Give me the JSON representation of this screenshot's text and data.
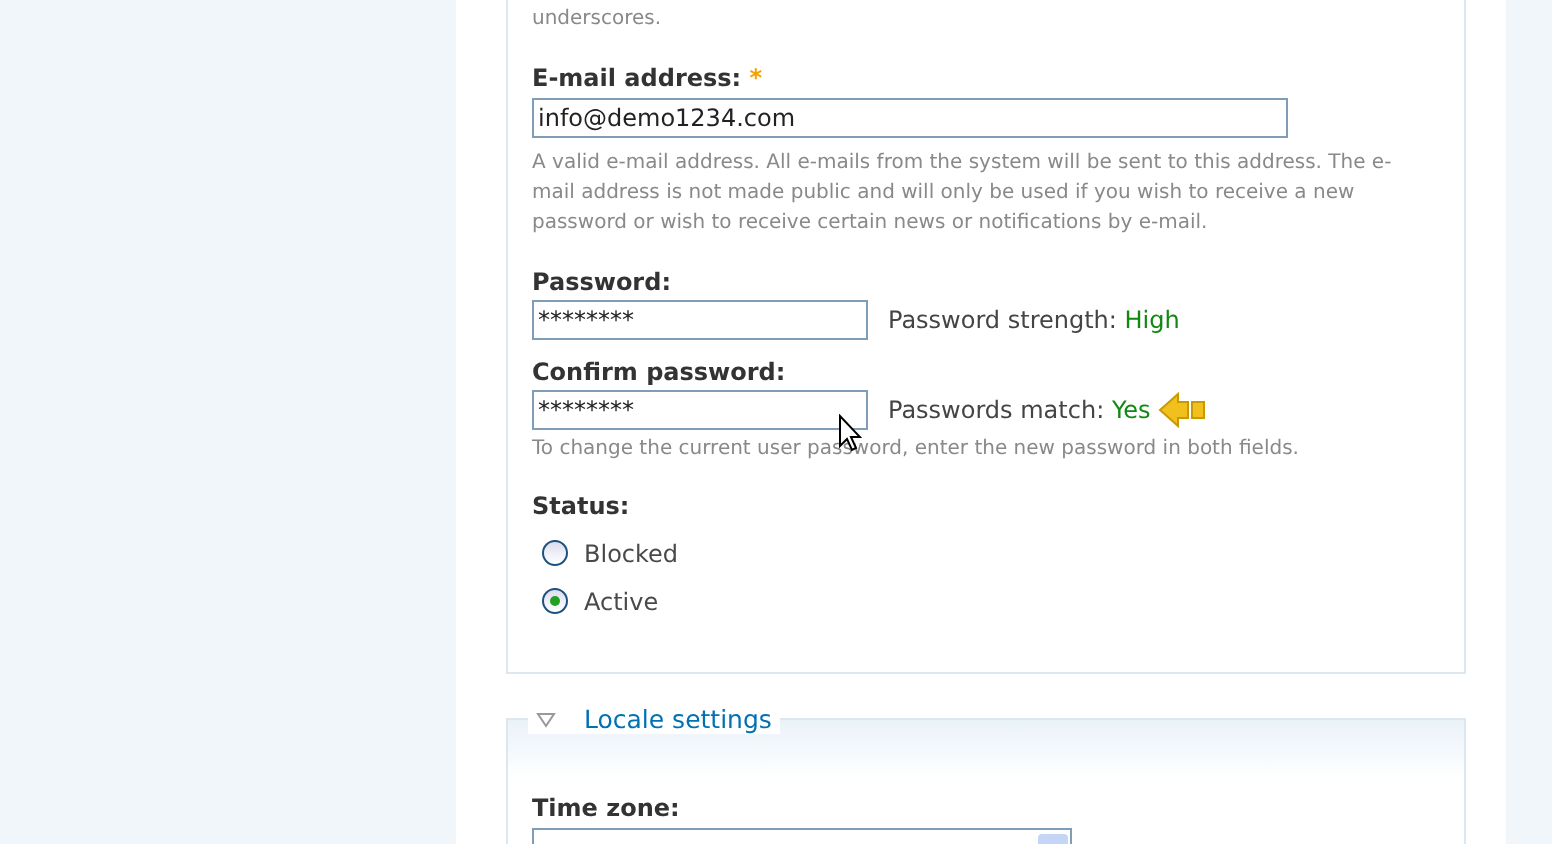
{
  "account": {
    "username_hint_tail": "underscores.",
    "email": {
      "label": "E-mail address:",
      "required_mark": "*",
      "value": "info@demo1234.com",
      "description": "A valid e-mail address. All e-mails from the system will be sent to this address. The e-mail address is not made public and will only be used if you wish to receive a new password or wish to receive certain news or notifications by e-mail."
    },
    "password": {
      "label": "Password:",
      "value": "********",
      "strength_label": "Password strength:",
      "strength_value": "High"
    },
    "confirm": {
      "label": "Confirm password:",
      "value": "********",
      "match_label": "Passwords match:",
      "match_value": "Yes"
    },
    "password_hint": "To change the current user password, enter the new password in both fields.",
    "status": {
      "label": "Status:",
      "options": [
        {
          "label": "Blocked",
          "selected": false
        },
        {
          "label": "Active",
          "selected": true
        }
      ]
    }
  },
  "locale": {
    "legend": "Locale settings",
    "expanded": true,
    "timezone_label": "Time zone:"
  }
}
